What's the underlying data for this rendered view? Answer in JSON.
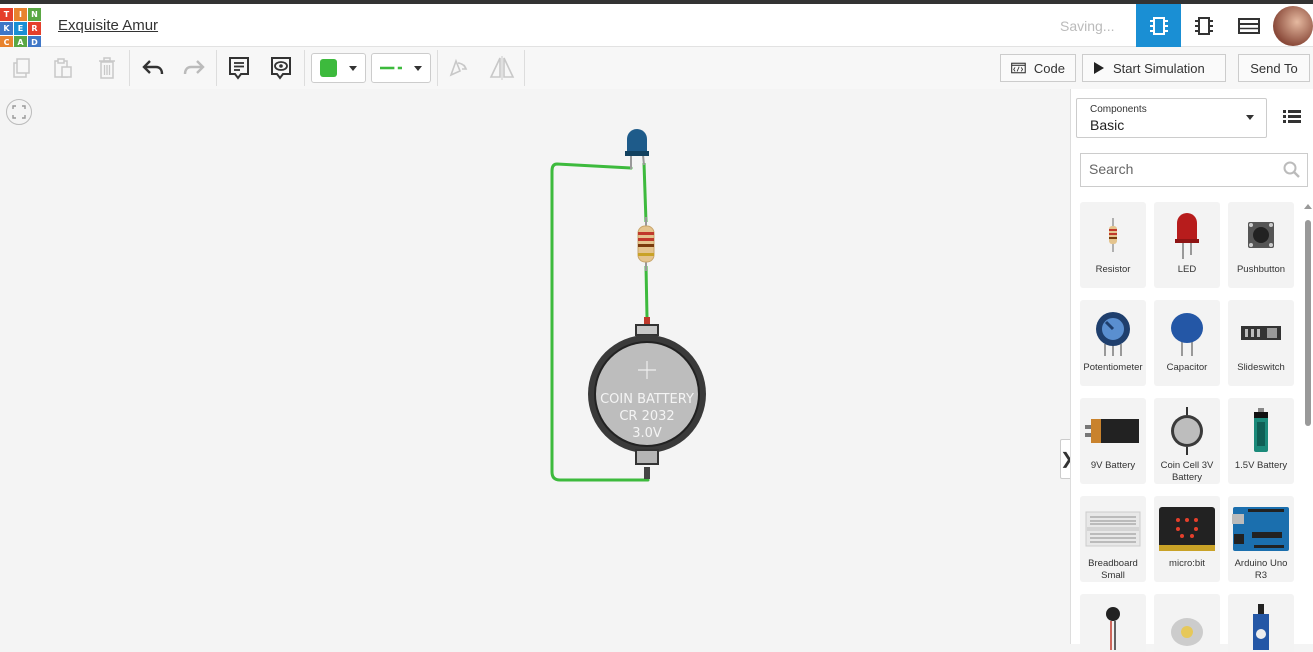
{
  "app": {
    "logo_letters": [
      "T",
      "I",
      "N",
      "K",
      "E",
      "R",
      "C",
      "A",
      "D"
    ],
    "logo_colors": [
      "#e53f2b",
      "#e8832e",
      "#5aa744",
      "#3f77c7",
      "#1a8fd4",
      "#e53f2b",
      "#e8832e",
      "#5aa744",
      "#3f77c7"
    ],
    "design_title": "Exquisite Amur",
    "save_status": "Saving..."
  },
  "views": [
    "circuit-view-icon",
    "component-view-icon",
    "schematic-list-icon"
  ],
  "toolbar": {
    "wire_color": "#3dba3d",
    "code_label": "Code",
    "start_label": "Start Simulation",
    "send_label": "Send To"
  },
  "panel": {
    "components_caption": "Components",
    "components_value": "Basic",
    "search_placeholder": "Search",
    "items": [
      {
        "name": "Resistor"
      },
      {
        "name": "LED"
      },
      {
        "name": "Pushbutton"
      },
      {
        "name": "Potentiometer"
      },
      {
        "name": "Capacitor"
      },
      {
        "name": "Slideswitch"
      },
      {
        "name": "9V Battery"
      },
      {
        "name": "Coin Cell 3V Battery"
      },
      {
        "name": "1.5V Battery"
      },
      {
        "name": "Breadboard Small"
      },
      {
        "name": "micro:bit"
      },
      {
        "name": "Arduino Uno R3"
      }
    ]
  },
  "circuit": {
    "battery_line1": "COIN BATTERY",
    "battery_line2": "CR 2032",
    "battery_line3": "3.0V",
    "wire_color": "#3dba3d",
    "led_color": "#1e5b8a"
  }
}
